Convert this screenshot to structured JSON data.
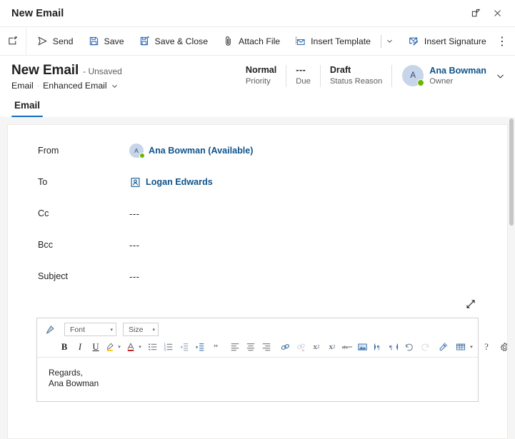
{
  "window": {
    "title": "New Email",
    "popout_icon": "open-in-new-window-icon",
    "close_icon": "close-icon"
  },
  "commandbar": {
    "new_icon": "new-record-icon",
    "buttons": [
      {
        "label": "Send",
        "icon": "send-icon"
      },
      {
        "label": "Save",
        "icon": "save-icon"
      },
      {
        "label": "Save & Close",
        "icon": "save-and-close-icon"
      },
      {
        "label": "Attach File",
        "icon": "paperclip-icon"
      },
      {
        "label": "Insert Template",
        "icon": "insert-template-icon"
      },
      {
        "label": "Insert Signature",
        "icon": "insert-signature-icon"
      }
    ],
    "template_caret": "chevron-down-icon",
    "overflow_label": "⋮"
  },
  "record_header": {
    "title": "New Email",
    "unsaved": "- Unsaved",
    "entity": "Email",
    "separator": "·",
    "form_name": "Enhanced Email",
    "form_caret": "chevron-down-icon",
    "fields": [
      {
        "value": "Normal",
        "label": "Priority"
      },
      {
        "value": "---",
        "label": "Due"
      },
      {
        "value": "Draft",
        "label": "Status Reason"
      }
    ],
    "owner": {
      "initial": "A",
      "name": "Ana Bowman",
      "role": "Owner",
      "presence": "available",
      "caret": "chevron-down-icon"
    }
  },
  "tabs": [
    {
      "label": "Email",
      "selected": true
    }
  ],
  "colors": {
    "accent": "#0f6cbd",
    "link": "#0f548c",
    "presence_green": "#6bb700",
    "canvas_bg": "#f5f5f5",
    "highlight_yellow": "#ffc000",
    "font_color_red": "#c00000"
  },
  "email_form": {
    "rows": [
      {
        "label": "From",
        "type": "person",
        "initial": "A",
        "value": "Ana Bowman (Available)"
      },
      {
        "label": "To",
        "type": "contact",
        "value": "Logan Edwards"
      },
      {
        "label": "Cc",
        "type": "empty",
        "value": "---"
      },
      {
        "label": "Bcc",
        "type": "empty",
        "value": "---"
      },
      {
        "label": "Subject",
        "type": "empty",
        "value": "---"
      }
    ],
    "expand_icon": "expand-diagonal-icon"
  },
  "editor": {
    "format_painter_icon": "format-painter-icon",
    "font_combo": {
      "value": "Font",
      "caret": "▾"
    },
    "size_combo": {
      "value": "Size",
      "caret": "▾"
    },
    "tools": [
      {
        "name": "bold",
        "glyph": "B"
      },
      {
        "name": "italic",
        "glyph": "I"
      },
      {
        "name": "underline",
        "glyph": "U"
      },
      {
        "name": "highlight-color",
        "glyph": "pen"
      },
      {
        "name": "font-color",
        "glyph": "A"
      },
      {
        "name": "bulleted-list",
        "glyph": "list"
      },
      {
        "name": "numbered-list",
        "glyph": "numlist"
      },
      {
        "name": "decrease-indent",
        "glyph": "outdent"
      },
      {
        "name": "increase-indent",
        "glyph": "indent"
      },
      {
        "name": "blockquote",
        "glyph": "”"
      },
      {
        "name": "align-left",
        "glyph": "alignleft"
      },
      {
        "name": "align-center",
        "glyph": "aligncenter"
      },
      {
        "name": "align-right",
        "glyph": "alignright"
      },
      {
        "name": "insert-link",
        "glyph": "link"
      },
      {
        "name": "remove-link",
        "glyph": "unlink",
        "disabled": true
      },
      {
        "name": "superscript",
        "glyph": "x2sup"
      },
      {
        "name": "subscript",
        "glyph": "x2sub"
      },
      {
        "name": "strikethrough",
        "glyph": "abc"
      },
      {
        "name": "insert-image",
        "glyph": "image"
      },
      {
        "name": "left-to-right",
        "glyph": "ltr"
      },
      {
        "name": "right-to-left",
        "glyph": "rtl"
      },
      {
        "name": "undo",
        "glyph": "undo"
      },
      {
        "name": "redo",
        "glyph": "redo",
        "disabled": true
      },
      {
        "name": "clear-formatting",
        "glyph": "eraser"
      },
      {
        "name": "insert-table",
        "glyph": "table"
      },
      {
        "name": "help",
        "glyph": "?"
      },
      {
        "name": "settings",
        "glyph": "gear"
      }
    ],
    "body_lines": [
      "Regards,",
      "Ana Bowman"
    ]
  }
}
